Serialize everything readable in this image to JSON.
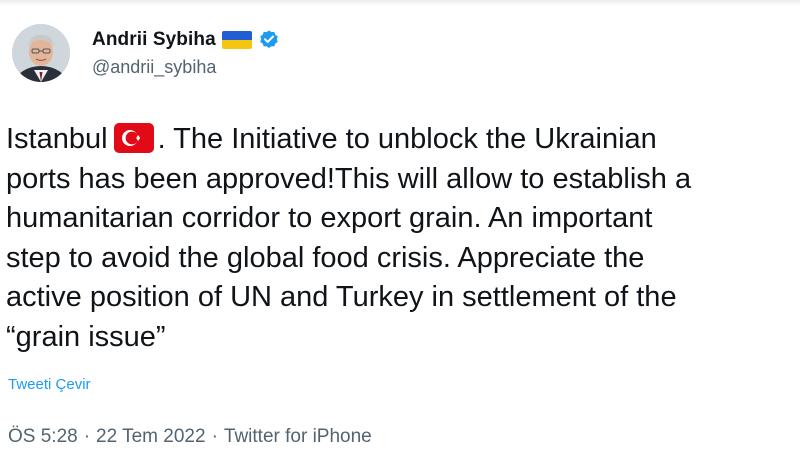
{
  "tweet": {
    "author": {
      "display_name": "Andrii Sybiha",
      "handle": "@andrii_sybiha",
      "flag_icon": "ukraine-flag-emoji",
      "verified_icon": "verified-badge",
      "verified_color": "#1d9bf0"
    },
    "text": {
      "line1_before_flag": "Istanbul",
      "flag_icon": "turkey-flag-emoji",
      "line1_after_flag": ". The Initiative to unblock the Ukrainian",
      "line2": "ports has been approved!This will allow to establish a",
      "line3": "humanitarian corridor to export grain. An important",
      "line4": "step to avoid the global food crisis. Appreciate the",
      "line5": "active position of UN and Turkey in settlement of the",
      "line6": "“grain issue”"
    },
    "translate_label": "Tweeti Çevir",
    "meta": {
      "time": "ÖS 5:28",
      "separator": "·",
      "date": "22 Tem 2022",
      "source": "Twitter for iPhone"
    }
  },
  "colors": {
    "text": "#0f1419",
    "secondary": "#536471",
    "link": "#1d9bf0"
  }
}
